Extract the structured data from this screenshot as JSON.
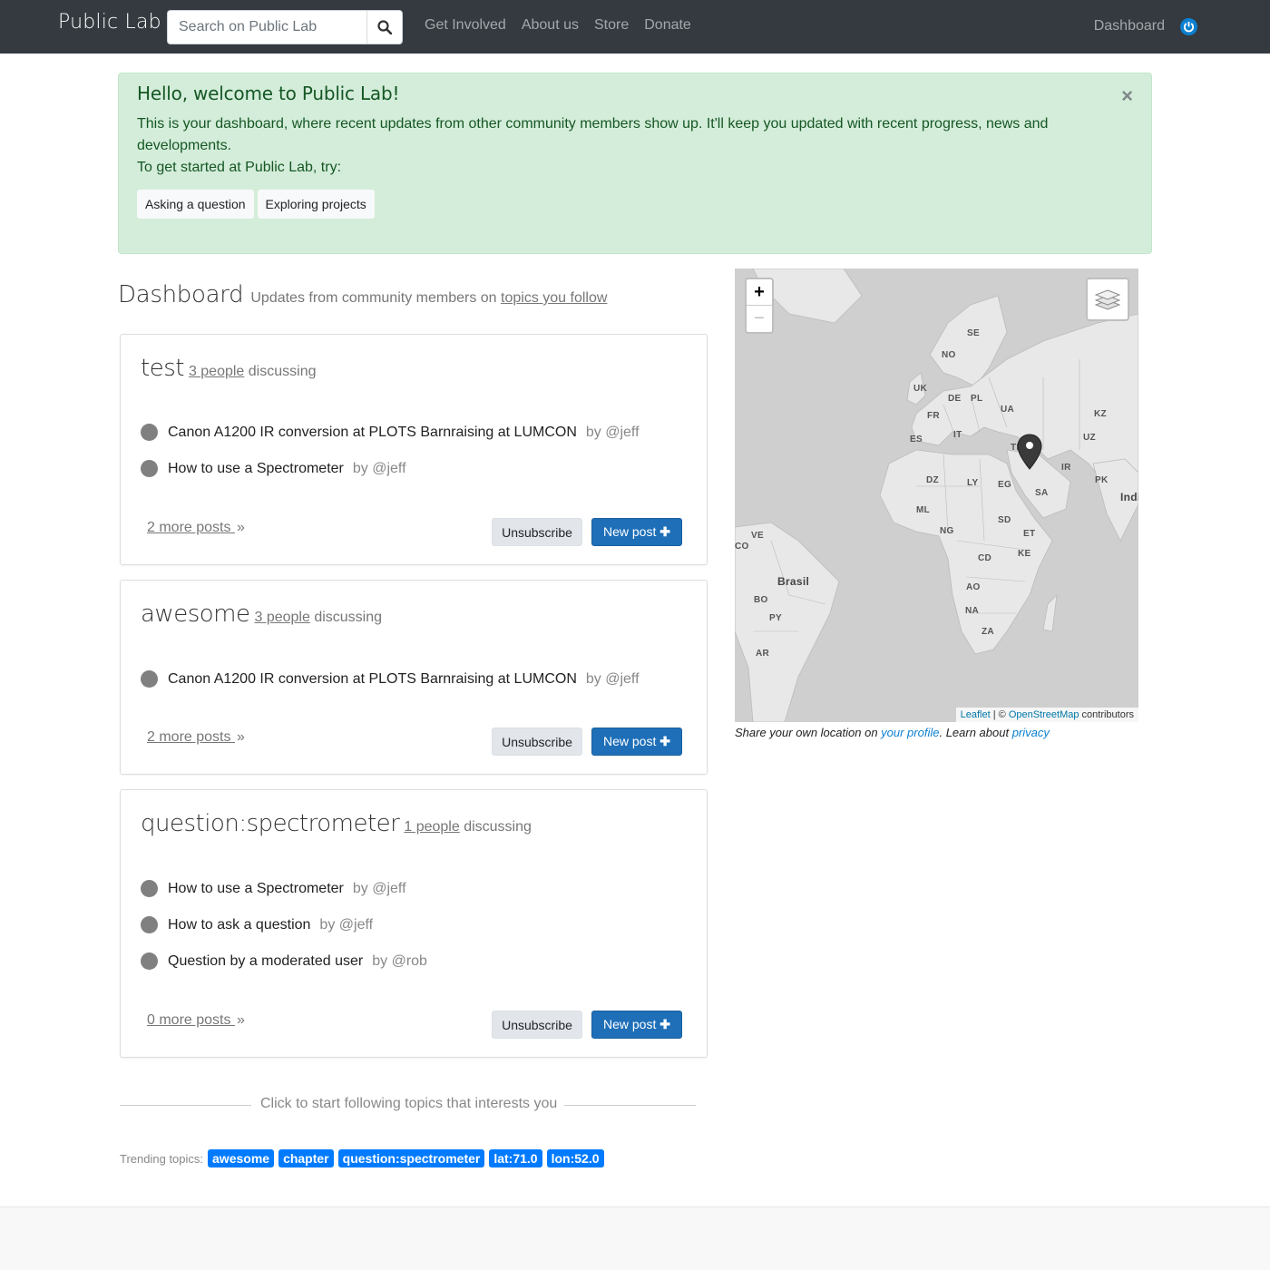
{
  "navbar": {
    "brand": "Public Lab",
    "search_placeholder": "Search on Public Lab",
    "links": [
      "Get Involved",
      "About us",
      "Store",
      "Donate"
    ],
    "dashboard_link": "Dashboard"
  },
  "alert": {
    "heading": "Hello, welcome to Public Lab!",
    "text1": "This is your dashboard, where recent updates from other community members show up. It'll keep you updated with recent progress, news and developments.",
    "text2": "To get started at Public Lab, try:",
    "buttons": [
      "Asking a question",
      "Exploring projects"
    ],
    "close": "×"
  },
  "dashboard": {
    "title": "Dashboard",
    "subtitle_prefix": "Updates from community members on",
    "subtitle_link": "topics you follow"
  },
  "cards": [
    {
      "tag": "test",
      "people": "3 people",
      "discussing": "discussing",
      "posts": [
        {
          "title": "Canon A1200 IR conversion at PLOTS Barnraising at LUMCON",
          "by": "by @jeff"
        },
        {
          "title": "How to use a Spectrometer",
          "by": "by @jeff"
        }
      ],
      "more": "2 more posts",
      "unsubscribe": "Unsubscribe",
      "new_post": "New post"
    },
    {
      "tag": "awesome",
      "people": "3 people",
      "discussing": "discussing",
      "posts": [
        {
          "title": "Canon A1200 IR conversion at PLOTS Barnraising at LUMCON",
          "by": "by @jeff"
        }
      ],
      "more": "2 more posts",
      "unsubscribe": "Unsubscribe",
      "new_post": "New post"
    },
    {
      "tag": "question:spectrometer",
      "people": "1 people",
      "discussing": "discussing",
      "posts": [
        {
          "title": "How to use a Spectrometer",
          "by": "by @jeff"
        },
        {
          "title": "How to ask a question",
          "by": "by @jeff"
        },
        {
          "title": "Question by a moderated user",
          "by": "by @rob"
        }
      ],
      "more": "0 more posts",
      "unsubscribe": "Unsubscribe",
      "new_post": "New post"
    }
  ],
  "follow_text": "Click to start following topics that interests you",
  "trending": {
    "label": "Trending topics:",
    "topics": [
      "awesome",
      "chapter",
      "question:spectrometer",
      "lat:71.0",
      "lon:52.0"
    ]
  },
  "map": {
    "zoom_in": "+",
    "zoom_out": "−",
    "attrib_leaflet": "Leaflet",
    "attrib_sep": " | © ",
    "attrib_osm": "OpenStreetMap",
    "attrib_contrib": " contributors",
    "labels": [
      "SE",
      "NO",
      "UK",
      "DE",
      "PL",
      "UA",
      "KZ",
      "FR",
      "ES",
      "IT",
      "TR",
      "UZ",
      "IR",
      "PK",
      "India",
      "DZ",
      "LY",
      "EG",
      "SA",
      "ML",
      "NG",
      "SD",
      "ET",
      "VE",
      "CO",
      "Brasil",
      "CD",
      "KE",
      "BO",
      "AO",
      "PY",
      "NA",
      "ZA",
      "AR"
    ],
    "caption_prefix": "Share your own location on ",
    "caption_link1": "your profile",
    "caption_mid": ". Learn about ",
    "caption_link2": "privacy"
  },
  "icons": {
    "search": "search-icon",
    "power": "power-icon",
    "plus": "plus-icon",
    "chevrons": "chevron-double-right-icon",
    "layers": "layers-icon",
    "marker": "map-marker-icon"
  },
  "colors": {
    "navbar": "#343a40",
    "alert_bg": "#d4edda",
    "alert_text": "#155724",
    "primary": "#1e6fb8",
    "badge": "#007bff"
  }
}
